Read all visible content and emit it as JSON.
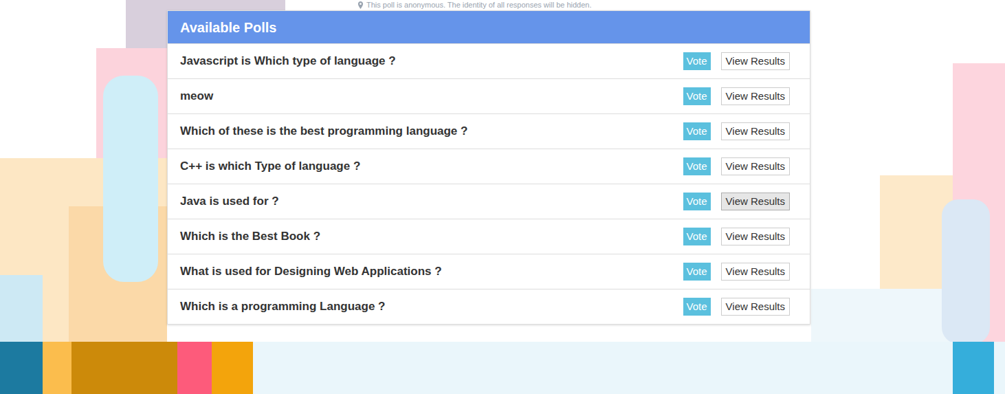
{
  "notice": {
    "text": "This poll is anonymous. The identity of all responses will be hidden."
  },
  "panel": {
    "title": "Available Polls"
  },
  "polls": [
    {
      "question": "Javascript is Which type of language ?",
      "vote": "Vote",
      "results": "View Results",
      "highlighted": false
    },
    {
      "question": "meow",
      "vote": "Vote",
      "results": "View Results",
      "highlighted": false
    },
    {
      "question": "Which of these is the best programming language ?",
      "vote": "Vote",
      "results": "View Results",
      "highlighted": false
    },
    {
      "question": "C++ is which Type of language ?",
      "vote": "Vote",
      "results": "View Results",
      "highlighted": false
    },
    {
      "question": "Java is used for ?",
      "vote": "Vote",
      "results": "View Results",
      "highlighted": true
    },
    {
      "question": "Which is the Best Book ?",
      "vote": "Vote",
      "results": "View Results",
      "highlighted": false
    },
    {
      "question": "What is used for Designing Web Applications ?",
      "vote": "Vote",
      "results": "View Results",
      "highlighted": false
    },
    {
      "question": "Which is a programming Language ?",
      "vote": "Vote",
      "results": "View Results",
      "highlighted": false
    }
  ]
}
